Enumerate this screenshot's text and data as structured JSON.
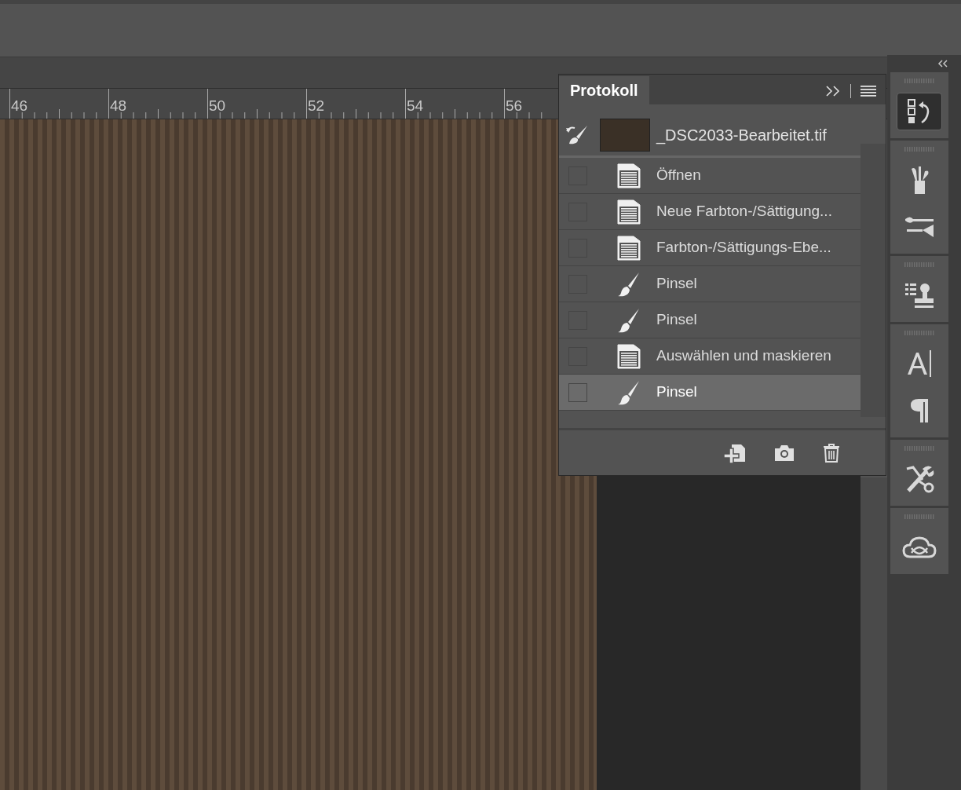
{
  "ruler": {
    "labels": [
      "46",
      "48",
      "50",
      "52",
      "54",
      "56"
    ]
  },
  "history_panel": {
    "title": "Protokoll",
    "snapshot": {
      "name": "_DSC2033-Bearbeitet.tif"
    },
    "items": [
      {
        "label": "Öffnen",
        "kind": "document",
        "checked": false,
        "selected": false
      },
      {
        "label": "Neue Farbton-/Sättigung...",
        "kind": "document",
        "checked": false,
        "selected": false
      },
      {
        "label": "Farbton-/Sättigungs-Ebe...",
        "kind": "document",
        "checked": false,
        "selected": false
      },
      {
        "label": "Pinsel",
        "kind": "brush",
        "checked": false,
        "selected": false
      },
      {
        "label": "Pinsel",
        "kind": "brush",
        "checked": false,
        "selected": false
      },
      {
        "label": "Auswählen und maskieren",
        "kind": "document",
        "checked": false,
        "selected": false
      },
      {
        "label": "Pinsel",
        "kind": "brush",
        "checked": false,
        "selected": true
      }
    ]
  },
  "dock": {
    "groups": [
      [
        {
          "kind": "history",
          "selected": true
        }
      ],
      [
        {
          "kind": "brushes",
          "selected": false
        },
        {
          "kind": "brush-settings",
          "selected": false
        }
      ],
      [
        {
          "kind": "clone-source",
          "selected": false
        }
      ],
      [
        {
          "kind": "character",
          "selected": false
        },
        {
          "kind": "paragraph",
          "selected": false
        }
      ],
      [
        {
          "kind": "tool-presets",
          "selected": false
        }
      ],
      [
        {
          "kind": "libraries",
          "selected": false
        }
      ]
    ]
  }
}
